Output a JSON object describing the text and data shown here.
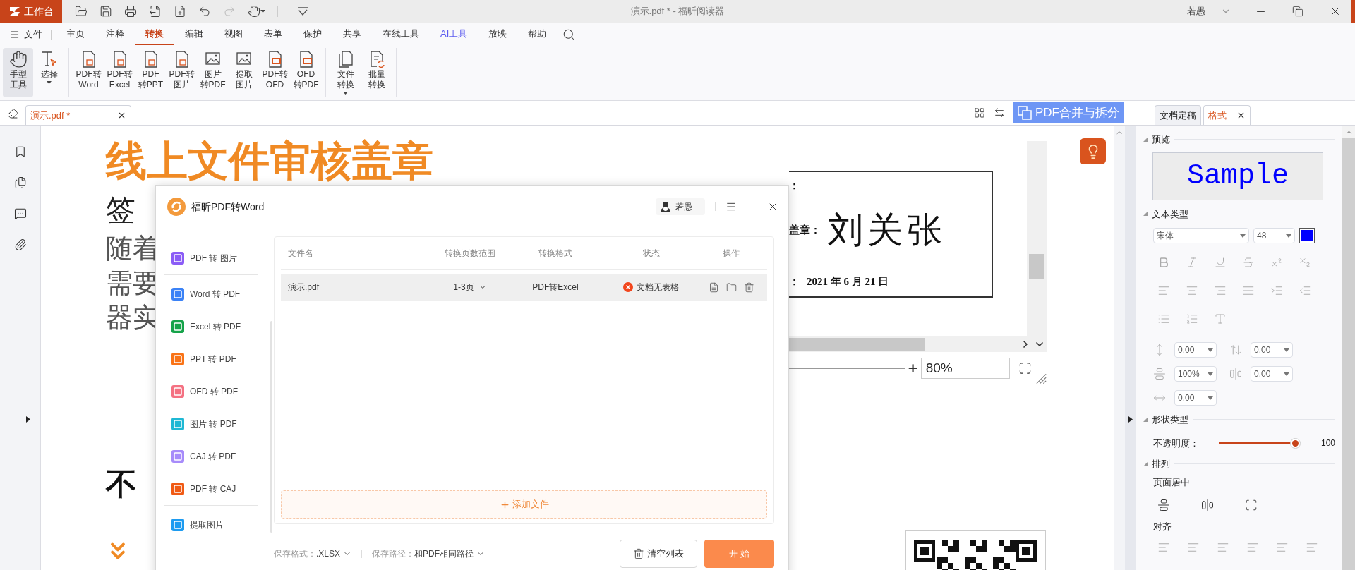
{
  "title_bar": {
    "app_button": "工作台",
    "title": "演示.pdf * - 福昕阅读器",
    "user": "若愚"
  },
  "menu": {
    "file": "文件",
    "items": [
      {
        "label": "主页",
        "selected": false,
        "kind": "plain"
      },
      {
        "label": "注释",
        "selected": false,
        "kind": "plain"
      },
      {
        "label": "转换",
        "selected": true,
        "kind": "plain"
      },
      {
        "label": "编辑",
        "selected": false,
        "kind": "plain"
      },
      {
        "label": "视图",
        "selected": false,
        "kind": "plain"
      },
      {
        "label": "表单",
        "selected": false,
        "kind": "plain"
      },
      {
        "label": "保护",
        "selected": false,
        "kind": "plain"
      },
      {
        "label": "共享",
        "selected": false,
        "kind": "plain"
      },
      {
        "label": "在线工具",
        "selected": false,
        "kind": "plain"
      },
      {
        "label": "AI工具",
        "selected": false,
        "kind": "ai"
      },
      {
        "label": "放映",
        "selected": false,
        "kind": "plain"
      },
      {
        "label": "帮助",
        "selected": false,
        "kind": "plain"
      }
    ]
  },
  "ribbon": {
    "groups": [
      [
        {
          "label": [
            "手型",
            "工具"
          ],
          "kind": "hand",
          "selected": true,
          "dropdown": false
        },
        {
          "label": [
            "选择"
          ],
          "kind": "select",
          "selected": false,
          "dropdown": true
        }
      ],
      [
        {
          "label": [
            "PDF转",
            "Word"
          ],
          "kind": "pdf-file",
          "selected": false,
          "dropdown": false
        },
        {
          "label": [
            "PDF转",
            "Excel"
          ],
          "kind": "pdf-file",
          "selected": false,
          "dropdown": false
        },
        {
          "label": [
            "PDF",
            "转PPT"
          ],
          "kind": "pdf-file",
          "selected": false,
          "dropdown": false
        },
        {
          "label": [
            "PDF转",
            "图片"
          ],
          "kind": "pdf-file",
          "selected": false,
          "dropdown": false
        },
        {
          "label": [
            "图片",
            "转PDF"
          ],
          "kind": "image",
          "selected": false,
          "dropdown": false
        },
        {
          "label": [
            "提取",
            "图片"
          ],
          "kind": "image",
          "selected": false,
          "dropdown": false
        },
        {
          "label": [
            "PDF转",
            "OFD"
          ],
          "kind": "ofd",
          "selected": false,
          "dropdown": false
        },
        {
          "label": [
            "OFD",
            "转PDF"
          ],
          "kind": "ofd",
          "selected": false,
          "dropdown": false
        }
      ],
      [
        {
          "label": [
            "文件",
            "转换"
          ],
          "kind": "files",
          "selected": false,
          "dropdown": true
        },
        {
          "label": [
            "批量",
            "转换"
          ],
          "kind": "batch",
          "selected": false,
          "dropdown": false
        }
      ]
    ]
  },
  "doc_tabs": [
    {
      "label": "演示.pdf *",
      "selected": true
    }
  ],
  "merge_button": "PDF合并与拆分",
  "document": {
    "headline": "线上文件审核盖章",
    "subtitle": "签",
    "paragraph_lines": [
      "随着",
      "需要",
      "器实"
    ],
    "heading_2": "不",
    "embedded": {
      "label_1": "：",
      "label_2": "盖章：",
      "signature": "刘关张",
      "date_label": "：",
      "date": "2021 年 6 月 21 日",
      "zoom": "80%"
    }
  },
  "dialog": {
    "title": "福昕PDF转Word",
    "user": "若愚",
    "nav_groups": [
      [
        {
          "label": "PDF 转 图片",
          "color": "#8b5cf6"
        }
      ],
      [
        {
          "label": "Word 转 PDF",
          "color": "#3b82f6"
        },
        {
          "label": "Excel 转 PDF",
          "color": "#16a34a"
        },
        {
          "label": "PPT 转 PDF",
          "color": "#f97316"
        },
        {
          "label": "OFD 转 PDF",
          "color": "#f47182"
        },
        {
          "label": "图片 转 PDF",
          "color": "#1fb8d4"
        },
        {
          "label": "CAJ 转 PDF",
          "color": "#a78bfa"
        },
        {
          "label": "PDF 转 CAJ",
          "color": "#f05a14"
        }
      ],
      [
        {
          "label": "提取图片",
          "color": "#1d9bf0"
        }
      ]
    ],
    "columns": [
      "文件名",
      "转换页数范围",
      "转换格式",
      "状态",
      "操作"
    ],
    "rows": [
      {
        "file": "演示.pdf",
        "pages": "1-3页",
        "format": "PDF转Excel",
        "status": "文档无表格",
        "selected": true
      }
    ],
    "add_file": "添加文件",
    "save_format_label": "保存格式：",
    "save_format": ".XLSX",
    "save_path_label": "保存路径：",
    "save_path": "和PDF相同路径",
    "clear_button": "清空列表",
    "start_button": "开 始"
  },
  "format_panel": {
    "tabs": [
      {
        "label": "文档定稿",
        "selected": false
      },
      {
        "label": "格式",
        "selected": true
      }
    ],
    "preview": "预览",
    "sample": "Sample",
    "text_type": "文本类型",
    "font": "宋体",
    "size": "48",
    "color": "#0000ff",
    "spacing": [
      "0.00",
      "0.00",
      "100%",
      "0.00",
      "0.00"
    ],
    "shape_type": "形状类型",
    "opacity_label": "不透明度：",
    "opacity": {
      "level": 1,
      "reading": "100"
    },
    "arrange": "排列",
    "page_center": "页面居中",
    "align": "对齐"
  }
}
